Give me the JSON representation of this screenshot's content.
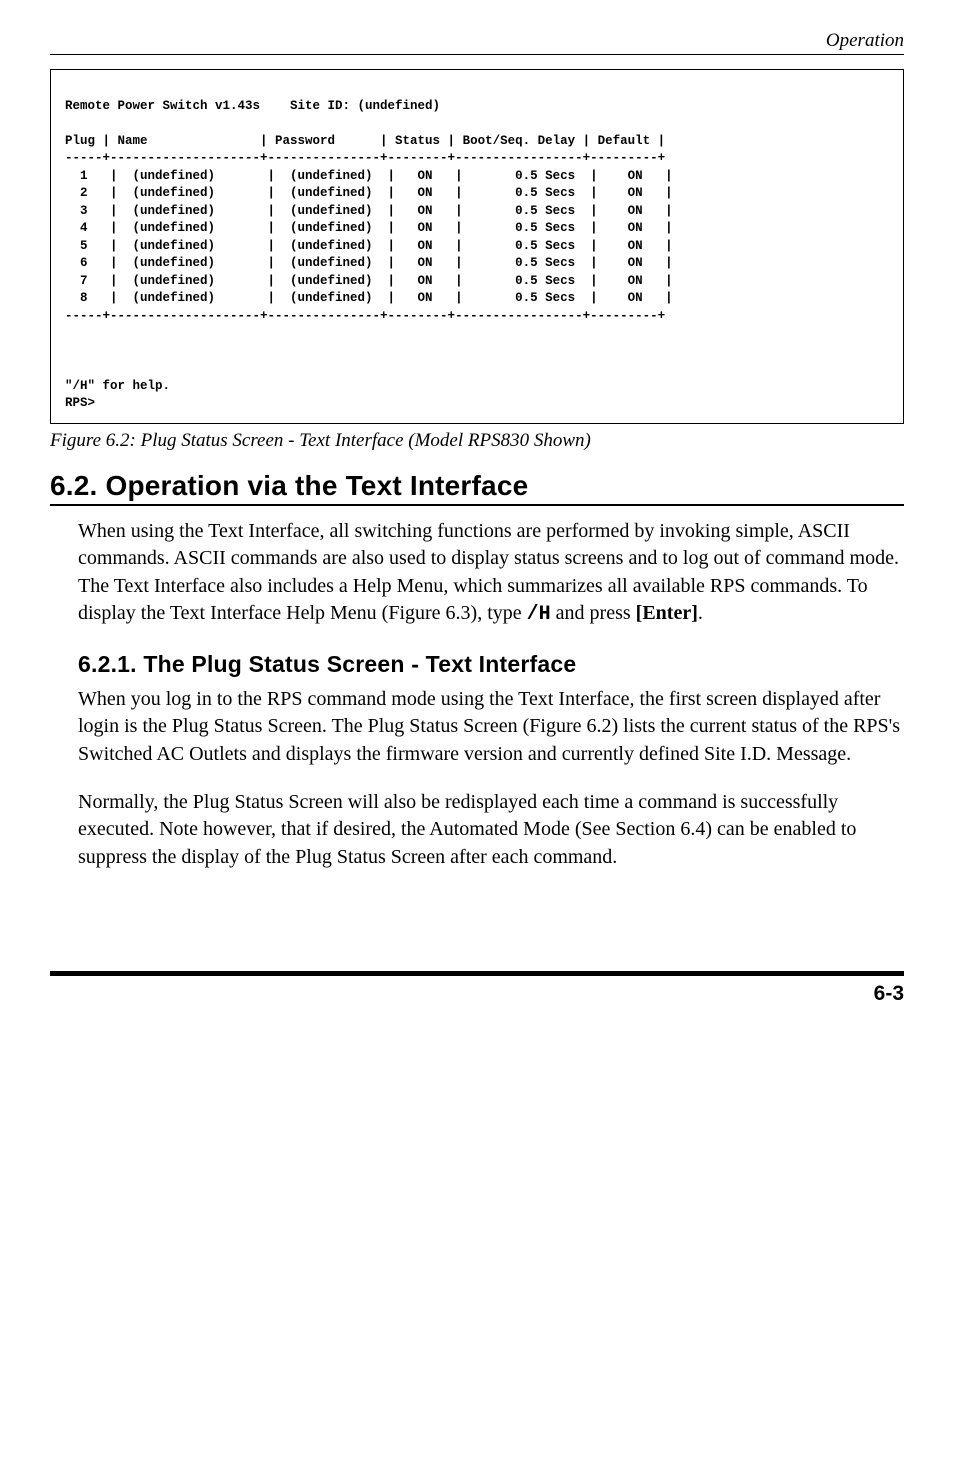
{
  "header": {
    "section": "Operation"
  },
  "terminal": {
    "title": "Remote Power Switch v1.43s    Site ID: (undefined)",
    "columns": "Plug | Name               | Password      | Status | Boot/Seq. Delay | Default |",
    "sep": "-----+--------------------+---------------+--------+-----------------+---------+",
    "rows": [
      "  1   |  (undefined)       |  (undefined)  |   ON   |       0.5 Secs  |    ON   |",
      "  2   |  (undefined)       |  (undefined)  |   ON   |       0.5 Secs  |    ON   |",
      "  3   |  (undefined)       |  (undefined)  |   ON   |       0.5 Secs  |    ON   |",
      "  4   |  (undefined)       |  (undefined)  |   ON   |       0.5 Secs  |    ON   |",
      "  5   |  (undefined)       |  (undefined)  |   ON   |       0.5 Secs  |    ON   |",
      "  6   |  (undefined)       |  (undefined)  |   ON   |       0.5 Secs  |    ON   |",
      "  7   |  (undefined)       |  (undefined)  |   ON   |       0.5 Secs  |    ON   |",
      "  8   |  (undefined)       |  (undefined)  |   ON   |       0.5 Secs  |    ON   |"
    ],
    "help": "\"/H\" for help.",
    "prompt": "RPS>"
  },
  "figure_caption": "Figure 6.2:  Plug Status Screen - Text Interface (Model RPS830 Shown)",
  "section_heading": "6.2.   Operation via the Text Interface",
  "para1a": "When using the Text Interface, all switching functions are performed by invoking simple, ASCII commands.  ASCII commands are also used to display status screens and to log out of command mode.  The Text Interface also includes a Help Menu, which summarizes all available RPS commands.  To display the Text Interface Help Menu (Figure 6.3), type ",
  "para1_code": "/H",
  "para1b": " and press ",
  "para1_enter": "[Enter]",
  "para1c": ".",
  "subsection_heading": "6.2.1.   The Plug Status Screen - Text Interface",
  "para2": "When you log in to the RPS command mode using the Text Interface, the first screen displayed after login is the Plug Status Screen.  The Plug Status Screen (Figure 6.2) lists the current status of the RPS's Switched AC Outlets and displays the firmware version and currently defined Site I.D. Message.",
  "para3": "Normally, the Plug Status Screen will also be redisplayed each time a command is successfully executed.  Note however, that if desired, the Automated Mode (See Section 6.4) can be enabled to suppress the display of the Plug Status Screen after each command.",
  "page_number": "6-3"
}
